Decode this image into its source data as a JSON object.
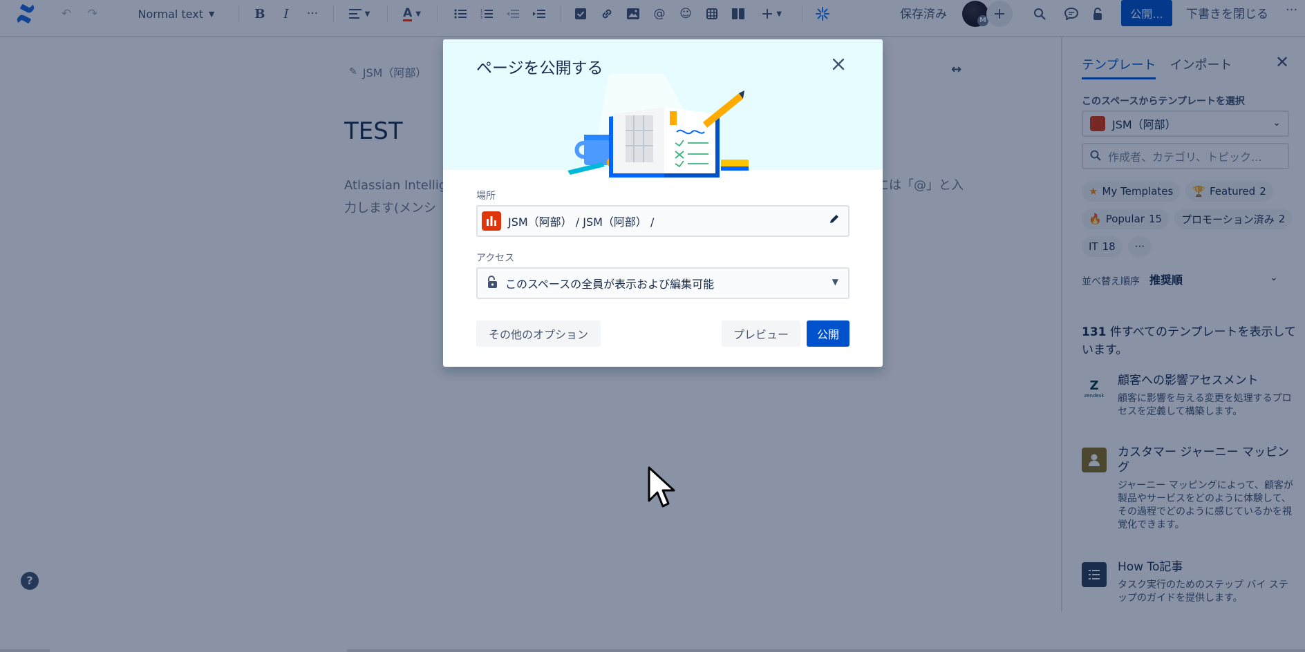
{
  "toolbar": {
    "text_style": "Normal text",
    "saved_status": "保存済み",
    "avatar_badge": "M",
    "publish_label": "公開...",
    "close_draft_label": "下書きを閉じる",
    "more_label": "···"
  },
  "editor": {
    "breadcrumb": "JSM（阿部）",
    "title": "TEST",
    "body_line1": "Atlassian Intellige",
    "body_line1_right": "には「@」と入",
    "body_line2": "力します(メンシ"
  },
  "right_panel": {
    "tabs": [
      {
        "label": "テンプレート",
        "active": true
      },
      {
        "label": "インポート",
        "active": false
      }
    ],
    "space_section_label": "このスペースからテンプレートを選択",
    "space_select_value": "JSM（阿部）",
    "search_placeholder": "作成者、カテゴリ、トピック...",
    "chips": [
      {
        "label": "My Templates",
        "count": "",
        "icon": "star-icon"
      },
      {
        "label": "Featured",
        "count": "2",
        "icon": "trophy-icon"
      },
      {
        "label": "Popular",
        "count": "15",
        "icon": "flame-icon"
      },
      {
        "label": "プロモーション済み",
        "count": "2",
        "icon": ""
      },
      {
        "label": "IT",
        "count": "18",
        "icon": ""
      },
      {
        "label": "···",
        "count": "",
        "icon": ""
      }
    ],
    "sort_label": "並べ替え順序",
    "sort_value": "推奨順",
    "count_number": "131",
    "count_text": " 件すべてのテンプレートを表示しています。",
    "templates": [
      {
        "title": "顧客への影響アセスメント",
        "desc": "顧客に影響を与える変更を処理するプロセスを定義して構築します。",
        "icon": "zendesk-icon",
        "icon_text": "Z"
      },
      {
        "title": "カスタマー ジャーニー マッピング",
        "desc": "ジャーニー マッピングによって、顧客が製品やサービスをどのように体験して、その過程でどのように感じているかを視覚化できます。",
        "icon": "person-icon",
        "icon_text": ""
      },
      {
        "title": "How To記事",
        "desc": "タスク実行のためのステップ バイ ステップのガイドを提供します。",
        "icon": "list-icon",
        "icon_text": ""
      }
    ]
  },
  "modal": {
    "title": "ページを公開する",
    "location_label": "場所",
    "location_value": "JSM（阿部） / JSM（阿部） /",
    "access_label": "アクセス",
    "access_value": "このスペースの全員が表示および編集可能",
    "other_options_label": "その他のオプション",
    "preview_label": "プレビュー",
    "publish_label": "公開"
  },
  "colors": {
    "brand": "#0052CC",
    "hero_bg": "#E6FCFF",
    "overlay": "rgba(9,30,66,0.48)"
  }
}
